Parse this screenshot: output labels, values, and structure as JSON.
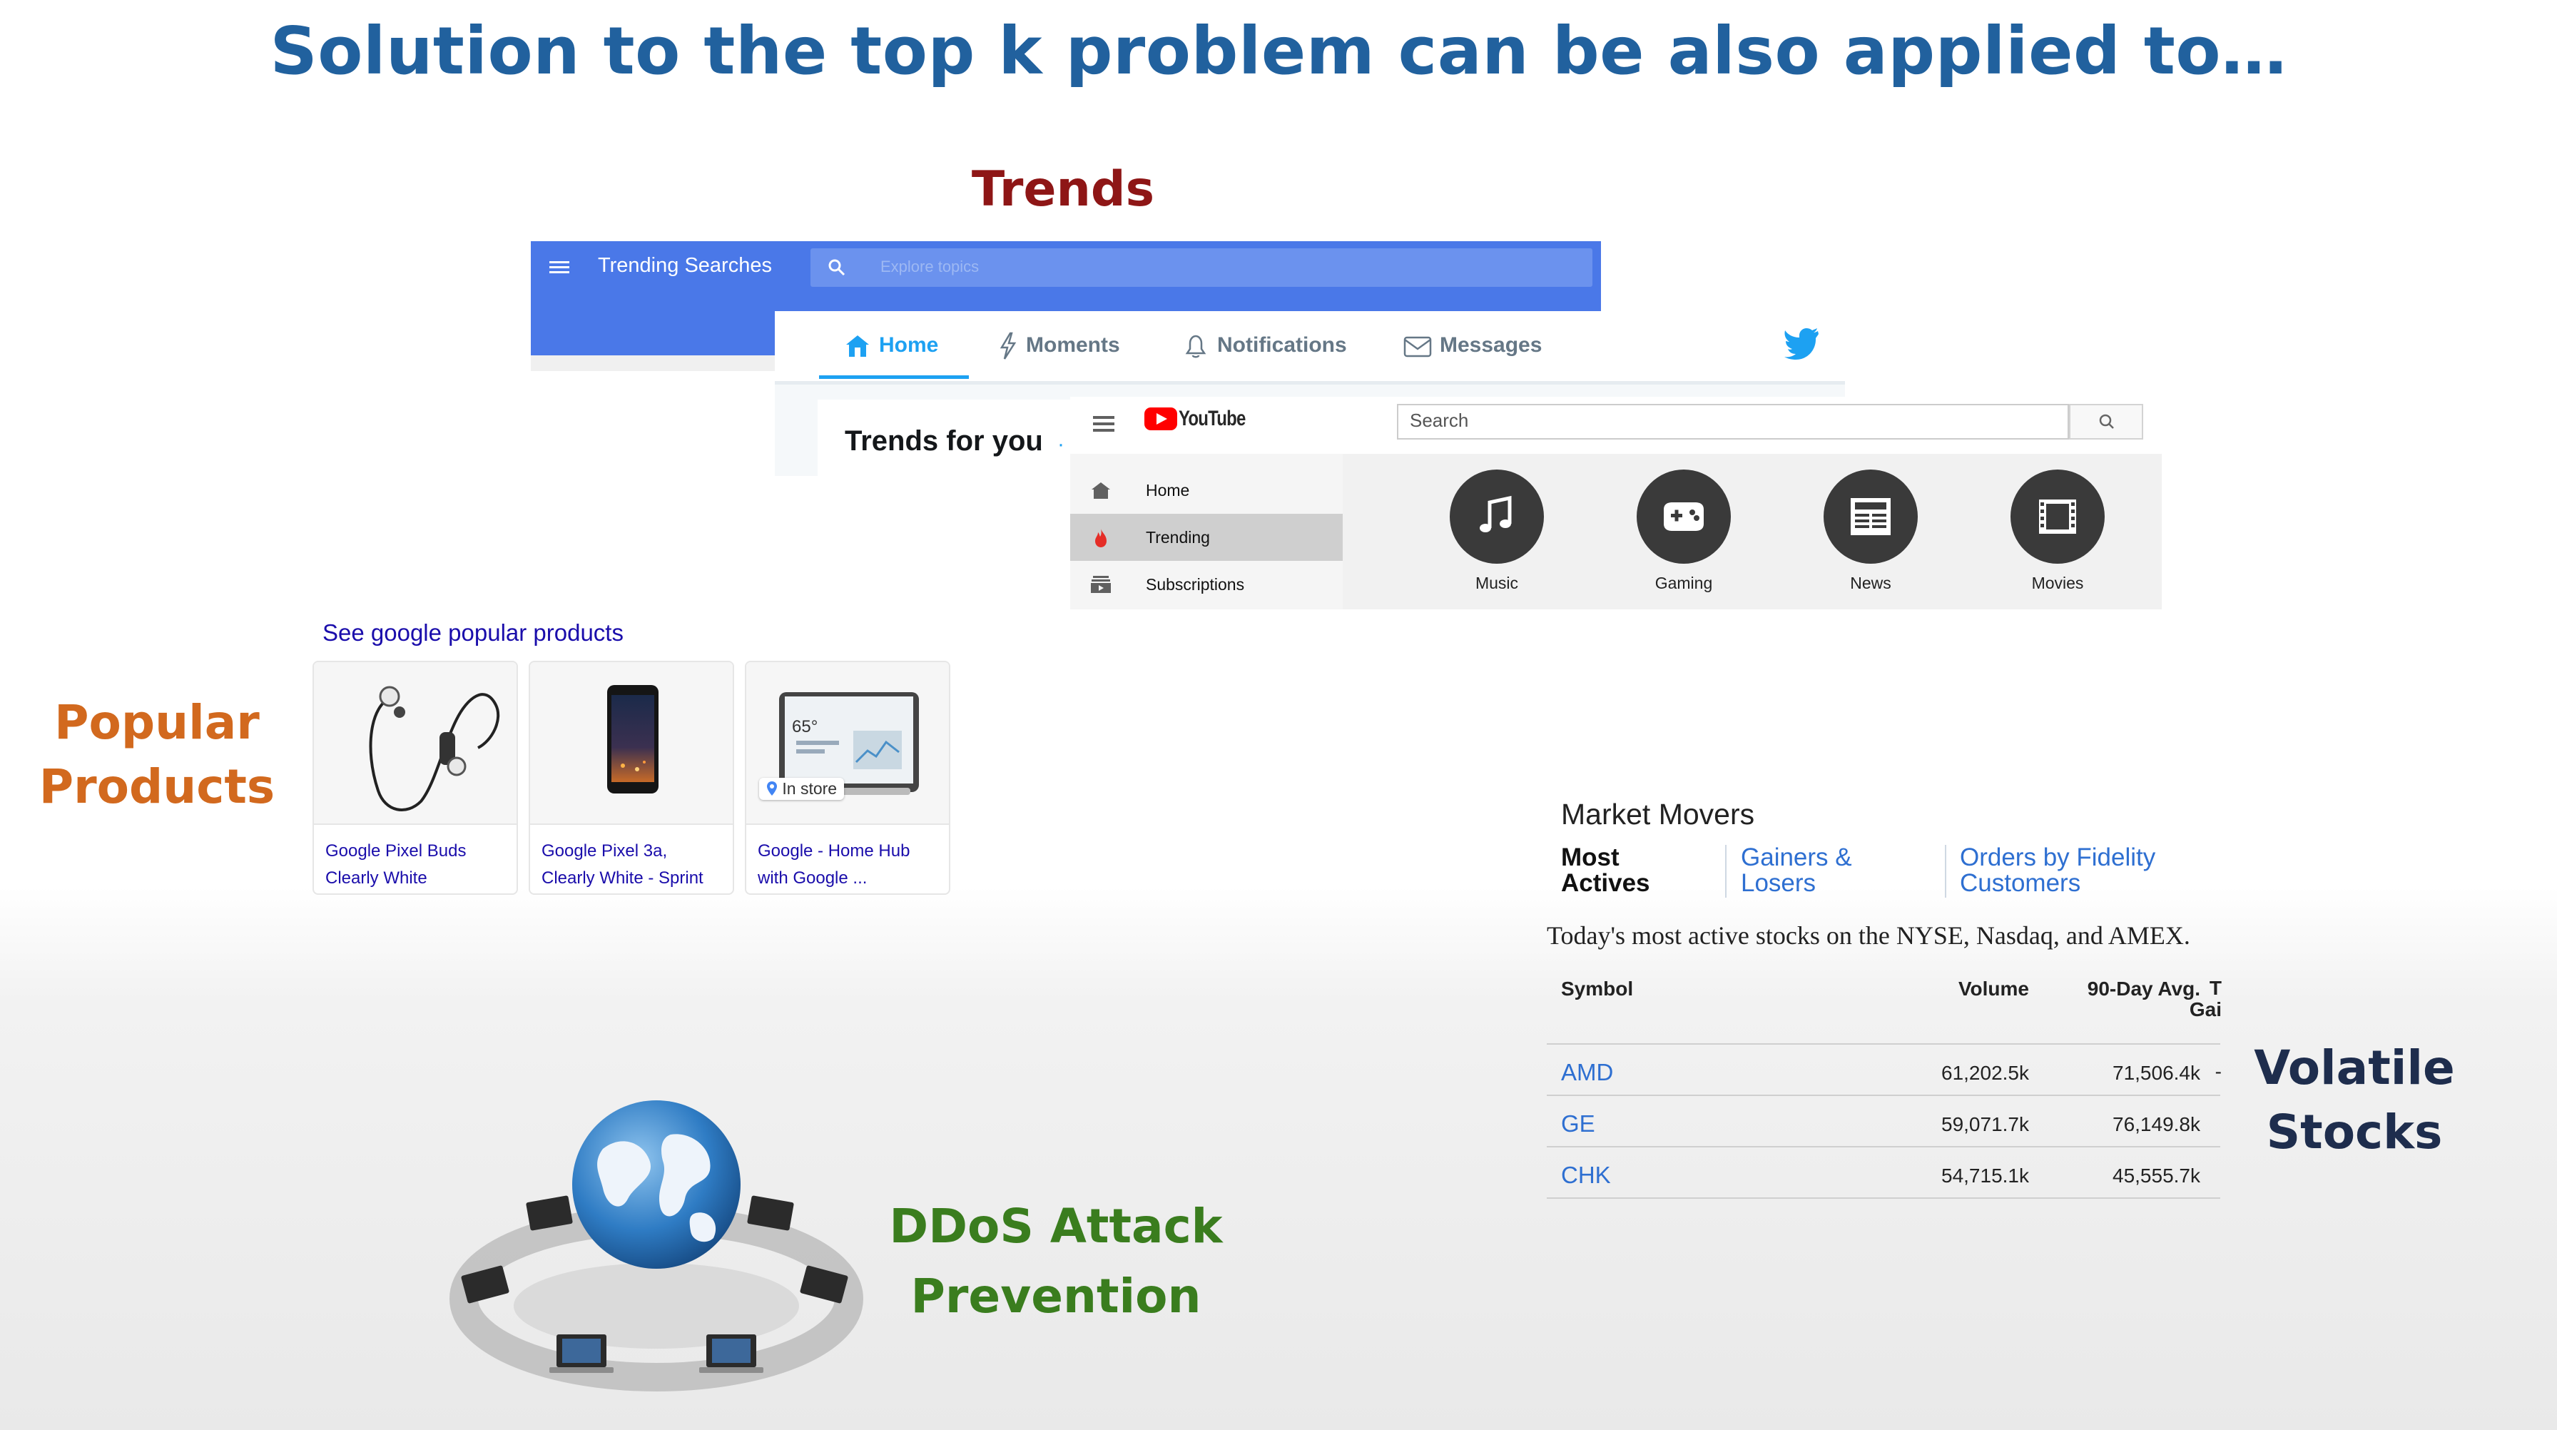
{
  "slide": {
    "title": "Solution to the top k problem can be also applied to…",
    "labels": {
      "trends": "Trends",
      "popular_products": [
        "Popular",
        "Products"
      ],
      "ddos": [
        "DDoS Attack",
        "Prevention"
      ],
      "volatile_stocks": [
        "Volatile",
        "Stocks"
      ]
    },
    "colors": {
      "title": "#21619e",
      "trends": "#8e1616",
      "popular": "#d2691e",
      "ddos": "#3a7d1e",
      "stocks": "#1e2d4d"
    }
  },
  "google_trends": {
    "title": "Trending Searches",
    "search_placeholder": "Explore topics",
    "accent": "#4a78e8"
  },
  "twitter": {
    "tabs": [
      "Home",
      "Moments",
      "Notifications",
      "Messages"
    ],
    "active_tab": "Home",
    "trends_title": "Trends for you",
    "trends_dot": "·",
    "accent": "#1da1f2"
  },
  "youtube": {
    "logo_text": "YouTube",
    "search_placeholder": "Search",
    "sidebar": [
      "Home",
      "Trending",
      "Subscriptions"
    ],
    "active_item": "Trending",
    "categories": [
      {
        "label": "Music",
        "icon": "music-note-icon"
      },
      {
        "label": "Gaming",
        "icon": "gamepad-icon"
      },
      {
        "label": "News",
        "icon": "newspaper-icon"
      },
      {
        "label": "Movies",
        "icon": "film-icon"
      }
    ]
  },
  "google_products": {
    "header": "See google popular products",
    "items": [
      {
        "name_line1": "Google Pixel Buds",
        "name_line2": "Clearly White"
      },
      {
        "name_line1": "Google Pixel 3a,",
        "name_line2": "Clearly White - Sprint"
      },
      {
        "name_line1": "Google - Home Hub",
        "name_line2": "with Google ...",
        "badge": "In store",
        "screen_temp": "65°"
      }
    ]
  },
  "market_movers": {
    "title": "Market Movers",
    "tabs": [
      {
        "line1": "Most",
        "line2": "Actives"
      },
      {
        "line1": "Gainers &",
        "line2": "Losers"
      },
      {
        "line1": "Orders by Fidelity",
        "line2": "Customers"
      }
    ],
    "active_tab": "Most Actives",
    "description": "Today's most active stocks on the NYSE, Nasdaq, and AMEX.",
    "columns": [
      "Symbol",
      "Volume",
      "90-Day Avg."
    ],
    "cut_column": {
      "line1": "T",
      "line2": "Gai"
    },
    "rows": [
      {
        "symbol": "AMD",
        "volume": "61,202.5k",
        "avg": "71,506.4k",
        "cut": "-"
      },
      {
        "symbol": "GE",
        "volume": "59,071.7k",
        "avg": "76,149.8k",
        "cut": ""
      },
      {
        "symbol": "CHK",
        "volume": "54,715.1k",
        "avg": "45,555.7k",
        "cut": ""
      }
    ]
  }
}
